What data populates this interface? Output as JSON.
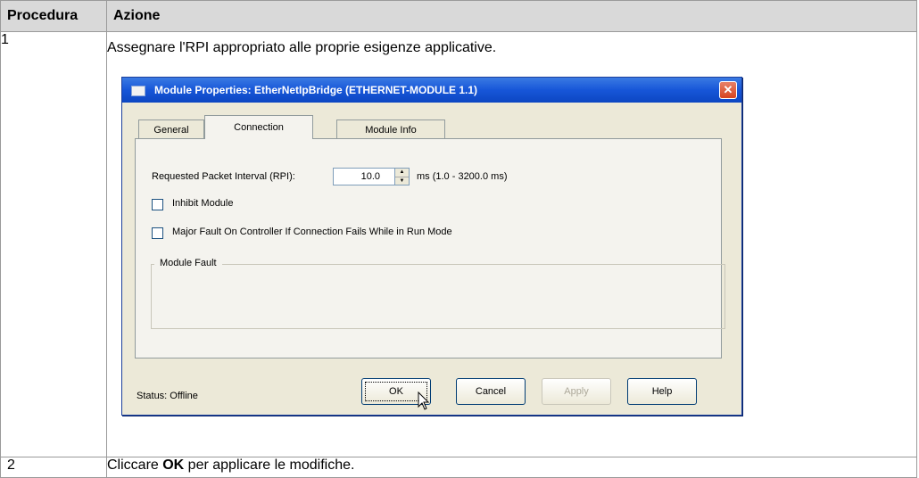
{
  "table": {
    "header_step": "Procedura",
    "header_action": "Azione",
    "rows": [
      {
        "num": "1",
        "text": "Assegnare l'RPI appropriato alle proprie esigenze applicative."
      },
      {
        "num": "2",
        "text_before": "Cliccare ",
        "text_bold": "OK",
        "text_after": " per applicare le modifiche."
      }
    ]
  },
  "dialog": {
    "title": "Module Properties: EtherNetIpBridge (ETHERNET-MODULE 1.1)",
    "close_glyph": "✕",
    "tabs": [
      {
        "label": "General"
      },
      {
        "label": "Connection",
        "active": true
      },
      {
        "label": "Module Info"
      }
    ],
    "rpi_label": "Requested Packet Interval (RPI):",
    "rpi_value": "10.0",
    "rpi_unit": "ms  (1.0 - 3200.0 ms)",
    "inhibit_label": "Inhibit Module",
    "inhibit_checked": false,
    "major_fault_label": "Major Fault On Controller If Connection Fails While in Run Mode",
    "major_fault_checked": false,
    "module_fault_label": "Module Fault",
    "status": "Status: Offline",
    "buttons": {
      "ok": "OK",
      "cancel": "Cancel",
      "apply": "Apply",
      "help": "Help"
    }
  }
}
